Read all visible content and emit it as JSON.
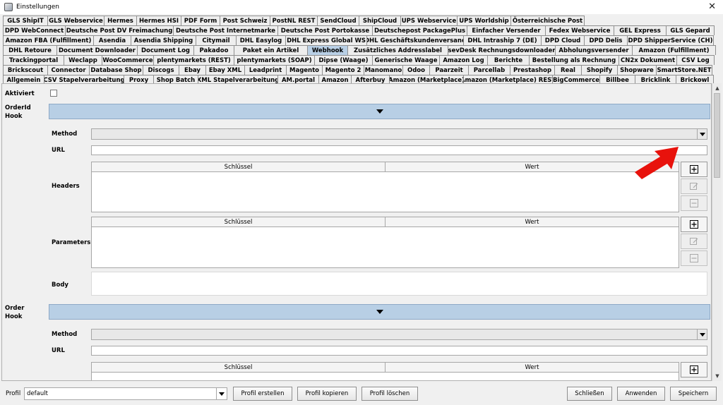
{
  "window": {
    "title": "Einstellungen",
    "close_glyph": "✕"
  },
  "tabs": {
    "rows": [
      [
        "GLS ShipIT",
        "GLS Webservice",
        "Hermes",
        "Hermes HSI",
        "PDF Form",
        "Post Schweiz",
        "PostNL REST",
        "SendCloud",
        "ShipCloud",
        "UPS Webservice",
        "UPS Worldship",
        "Österreichische Post"
      ],
      [
        "DPD WebConnect",
        "Deutsche Post DV Freimachung",
        "Deutsche Post Internetmarke",
        "Deutsche Post Portokasse",
        "Deutschepost PackagePlus",
        "Einfacher Versender",
        "Fedex Webservice",
        "GEL Express",
        "GLS Gepard"
      ],
      [
        "Amazon FBA (Fulfillment)",
        "Asendia",
        "Asendia Shipping",
        "Citymail",
        "DHL Easylog",
        "DHL Express Global WS",
        "DHL Geschäftskundenversand",
        "DHL Intraship 7 (DE)",
        "DPD Cloud",
        "DPD Delis",
        "DPD ShipperService (CH)"
      ],
      [
        "DHL Retoure",
        "Document Downloader",
        "Document Log",
        "Pakadoo",
        "Paket ein Artikel",
        "Webhook",
        "Zusätzliches Addresslabel",
        "sevDesk Rechnungsdownloader",
        "Abholungsversender",
        "Amazon (Fulfillment)"
      ],
      [
        "Trackingportal",
        "Weclapp",
        "WooCommerce",
        "plentymarkets (REST)",
        "plentymarkets (SOAP)",
        "Dipse (Waage)",
        "Generische Waage",
        "Amazon Log",
        "Berichte",
        "Bestellung als Rechnung",
        "CN2x Dokument",
        "CSV Log"
      ],
      [
        "Brickscout",
        "Connector",
        "Database Shop",
        "Discogs",
        "Ebay",
        "Ebay XML",
        "Leadprint",
        "Magento",
        "Magento 2",
        "Manomano",
        "Odoo",
        "Paarzeit",
        "Parcellab",
        "Prestashop",
        "Real",
        "Shopify",
        "Shopware",
        "SmartStore.NET"
      ],
      [
        "Allgemein",
        "CSV Stapelverarbeitung",
        "Proxy",
        "Shop Batch",
        "XML Stapelverarbeitung",
        "AM.portal",
        "Amazon",
        "Afterbuy",
        "Amazon (Marketplace)",
        "Amazon (Marketplace) REST",
        "BigCommerce",
        "Billbee",
        "Bricklink",
        "Brickowl"
      ]
    ],
    "active": "Webhook"
  },
  "form": {
    "aktiviert_label": "Aktiviert",
    "orderid_hook_label_1": "OrderId",
    "orderid_hook_label_2": "Hook",
    "order_hook_label_1": "Order",
    "order_hook_label_2": "Hook",
    "method_label": "Method",
    "url_label": "URL",
    "headers_label": "Headers",
    "parameters_label": "Parameters",
    "body_label": "Body",
    "col_key": "Schlüssel",
    "col_value": "Wert"
  },
  "icons": {
    "add": "add-icon",
    "edit": "edit-icon",
    "remove": "remove-icon"
  },
  "colors": {
    "tab_active": "#b8cfe5",
    "hook_bar": "#b8cfe5",
    "annotation_arrow": "#e8120c"
  },
  "footer": {
    "profil_label": "Profil",
    "profil_value": "default",
    "btn_create": "Profil erstellen",
    "btn_copy": "Profil kopieren",
    "btn_delete": "Profil löschen",
    "btn_close": "Schließen",
    "btn_apply": "Anwenden",
    "btn_save": "Speichern"
  }
}
